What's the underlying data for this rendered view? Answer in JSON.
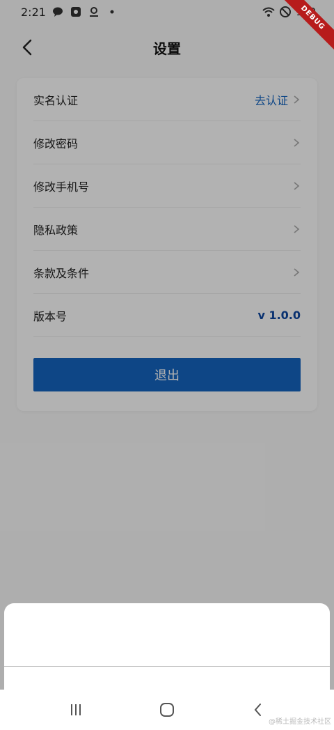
{
  "status_bar": {
    "time": "2:21",
    "battery": "100",
    "debug_label": "DEBUG"
  },
  "app_bar": {
    "title": "设置"
  },
  "settings": {
    "items": [
      {
        "label": "实名认证",
        "value": "去认证",
        "chevron": true
      },
      {
        "label": "修改密码",
        "value": "",
        "chevron": true
      },
      {
        "label": "修改手机号",
        "value": "",
        "chevron": true
      },
      {
        "label": "隐私政策",
        "value": "",
        "chevron": true
      },
      {
        "label": "条款及条件",
        "value": "",
        "chevron": true
      },
      {
        "label": "版本号",
        "value": "v 1.0.0",
        "chevron": false
      }
    ],
    "logout_label": "退出"
  },
  "watermark": "@稀土掘金技术社区",
  "colors": {
    "accent": "#1565c0",
    "version": "#0d47a1",
    "scrim": "rgba(0,0,0,0.30)"
  },
  "icons": {
    "back": "chevron-left-icon",
    "row": "chevron-right-icon",
    "nav_recent": "recent-apps-icon",
    "nav_home": "home-icon",
    "nav_back": "back-icon"
  }
}
